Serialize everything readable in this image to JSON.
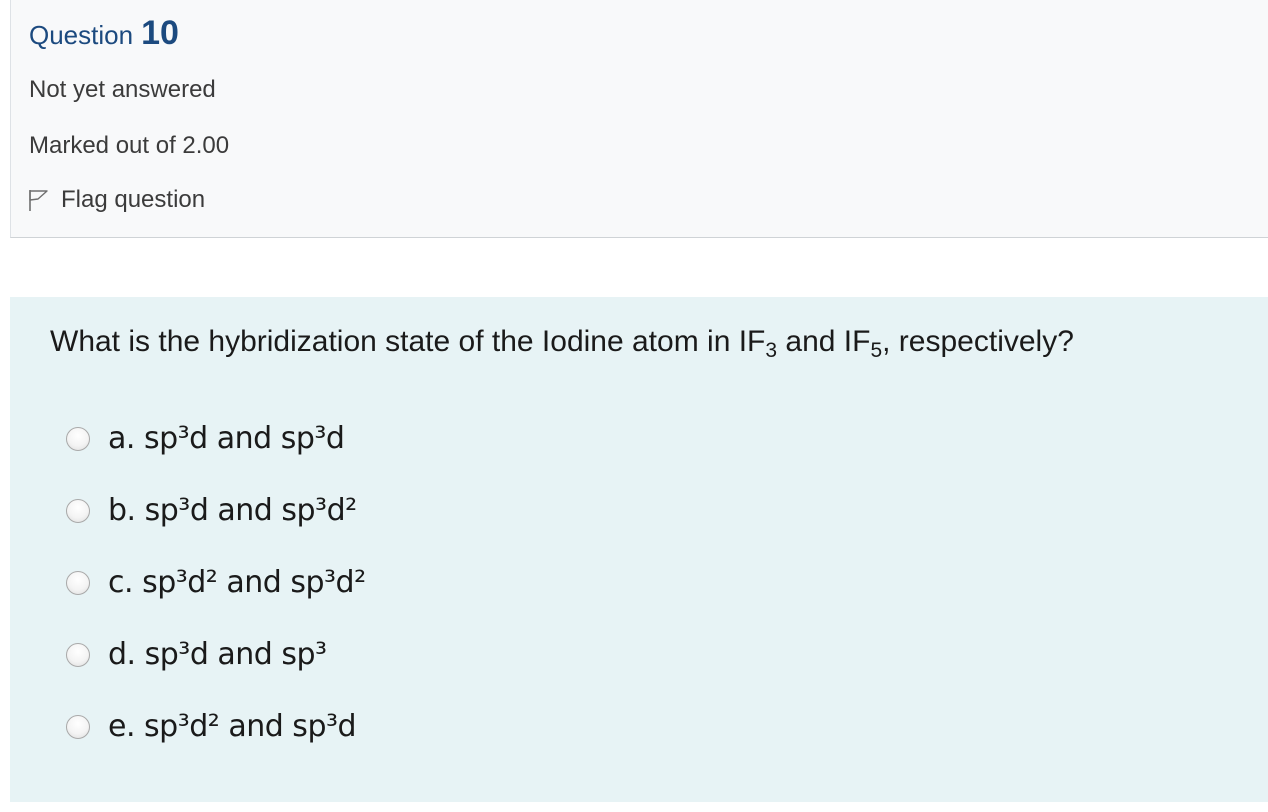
{
  "info": {
    "question_word": "Question",
    "question_number": "10",
    "state": "Not yet answered",
    "grade": "Marked out of 2.00",
    "flag_label": "Flag question",
    "flag_icon": "flag-icon"
  },
  "question": {
    "text_before": "What is the hybridization state of the Iodine atom in IF",
    "sub1": "3",
    "text_mid": " and IF",
    "sub2": "5",
    "text_after": ", respectively?"
  },
  "answers": [
    {
      "label": "a. sp³d and sp³d",
      "selected": false
    },
    {
      "label": "b. sp³d and sp³d²",
      "selected": false
    },
    {
      "label": "c. sp³d² and sp³d²",
      "selected": false
    },
    {
      "label": "d. sp³d and sp³",
      "selected": false
    },
    {
      "label": "e. sp³d² and sp³d",
      "selected": false
    }
  ],
  "colors": {
    "heading": "#1c4a7f",
    "info_bg": "#f8f9fa",
    "content_bg": "#e7f3f5"
  }
}
